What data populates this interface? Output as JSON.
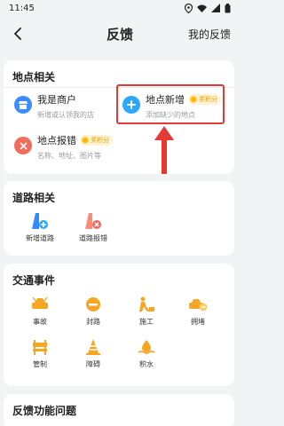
{
  "status_bar": {
    "time": "11:45"
  },
  "header": {
    "title": "反馈",
    "my_feedback": "我的反馈"
  },
  "location_section": {
    "title": "地点相关",
    "items": [
      {
        "title": "我是商户",
        "subtitle": "新增或认领我的店",
        "badge": ""
      },
      {
        "title": "地点新增",
        "subtitle": "添加缺少的地点",
        "badge": "奖积分"
      },
      {
        "title": "地点报错",
        "subtitle": "名称、地址、图片等",
        "badge": "奖积分"
      }
    ]
  },
  "road_section": {
    "title": "道路相关",
    "items": [
      {
        "label": "新增道路",
        "icon": "road-add-icon"
      },
      {
        "label": "道路报错",
        "icon": "road-error-icon"
      }
    ]
  },
  "traffic_section": {
    "title": "交通事件",
    "items": [
      {
        "label": "事故",
        "icon": "accident-icon"
      },
      {
        "label": "封路",
        "icon": "road-closed-icon"
      },
      {
        "label": "施工",
        "icon": "construction-icon"
      },
      {
        "label": "拥堵",
        "icon": "congestion-icon"
      },
      {
        "label": "管制",
        "icon": "control-icon"
      },
      {
        "label": "障碍",
        "icon": "obstacle-icon"
      },
      {
        "label": "积水",
        "icon": "flooding-icon"
      }
    ]
  },
  "feature_section": {
    "title": "反馈功能问题"
  },
  "colors": {
    "accent": "#1e88ff",
    "traffic": "#f5a623",
    "error": "#f26b5b",
    "highlight": "#e53935"
  }
}
